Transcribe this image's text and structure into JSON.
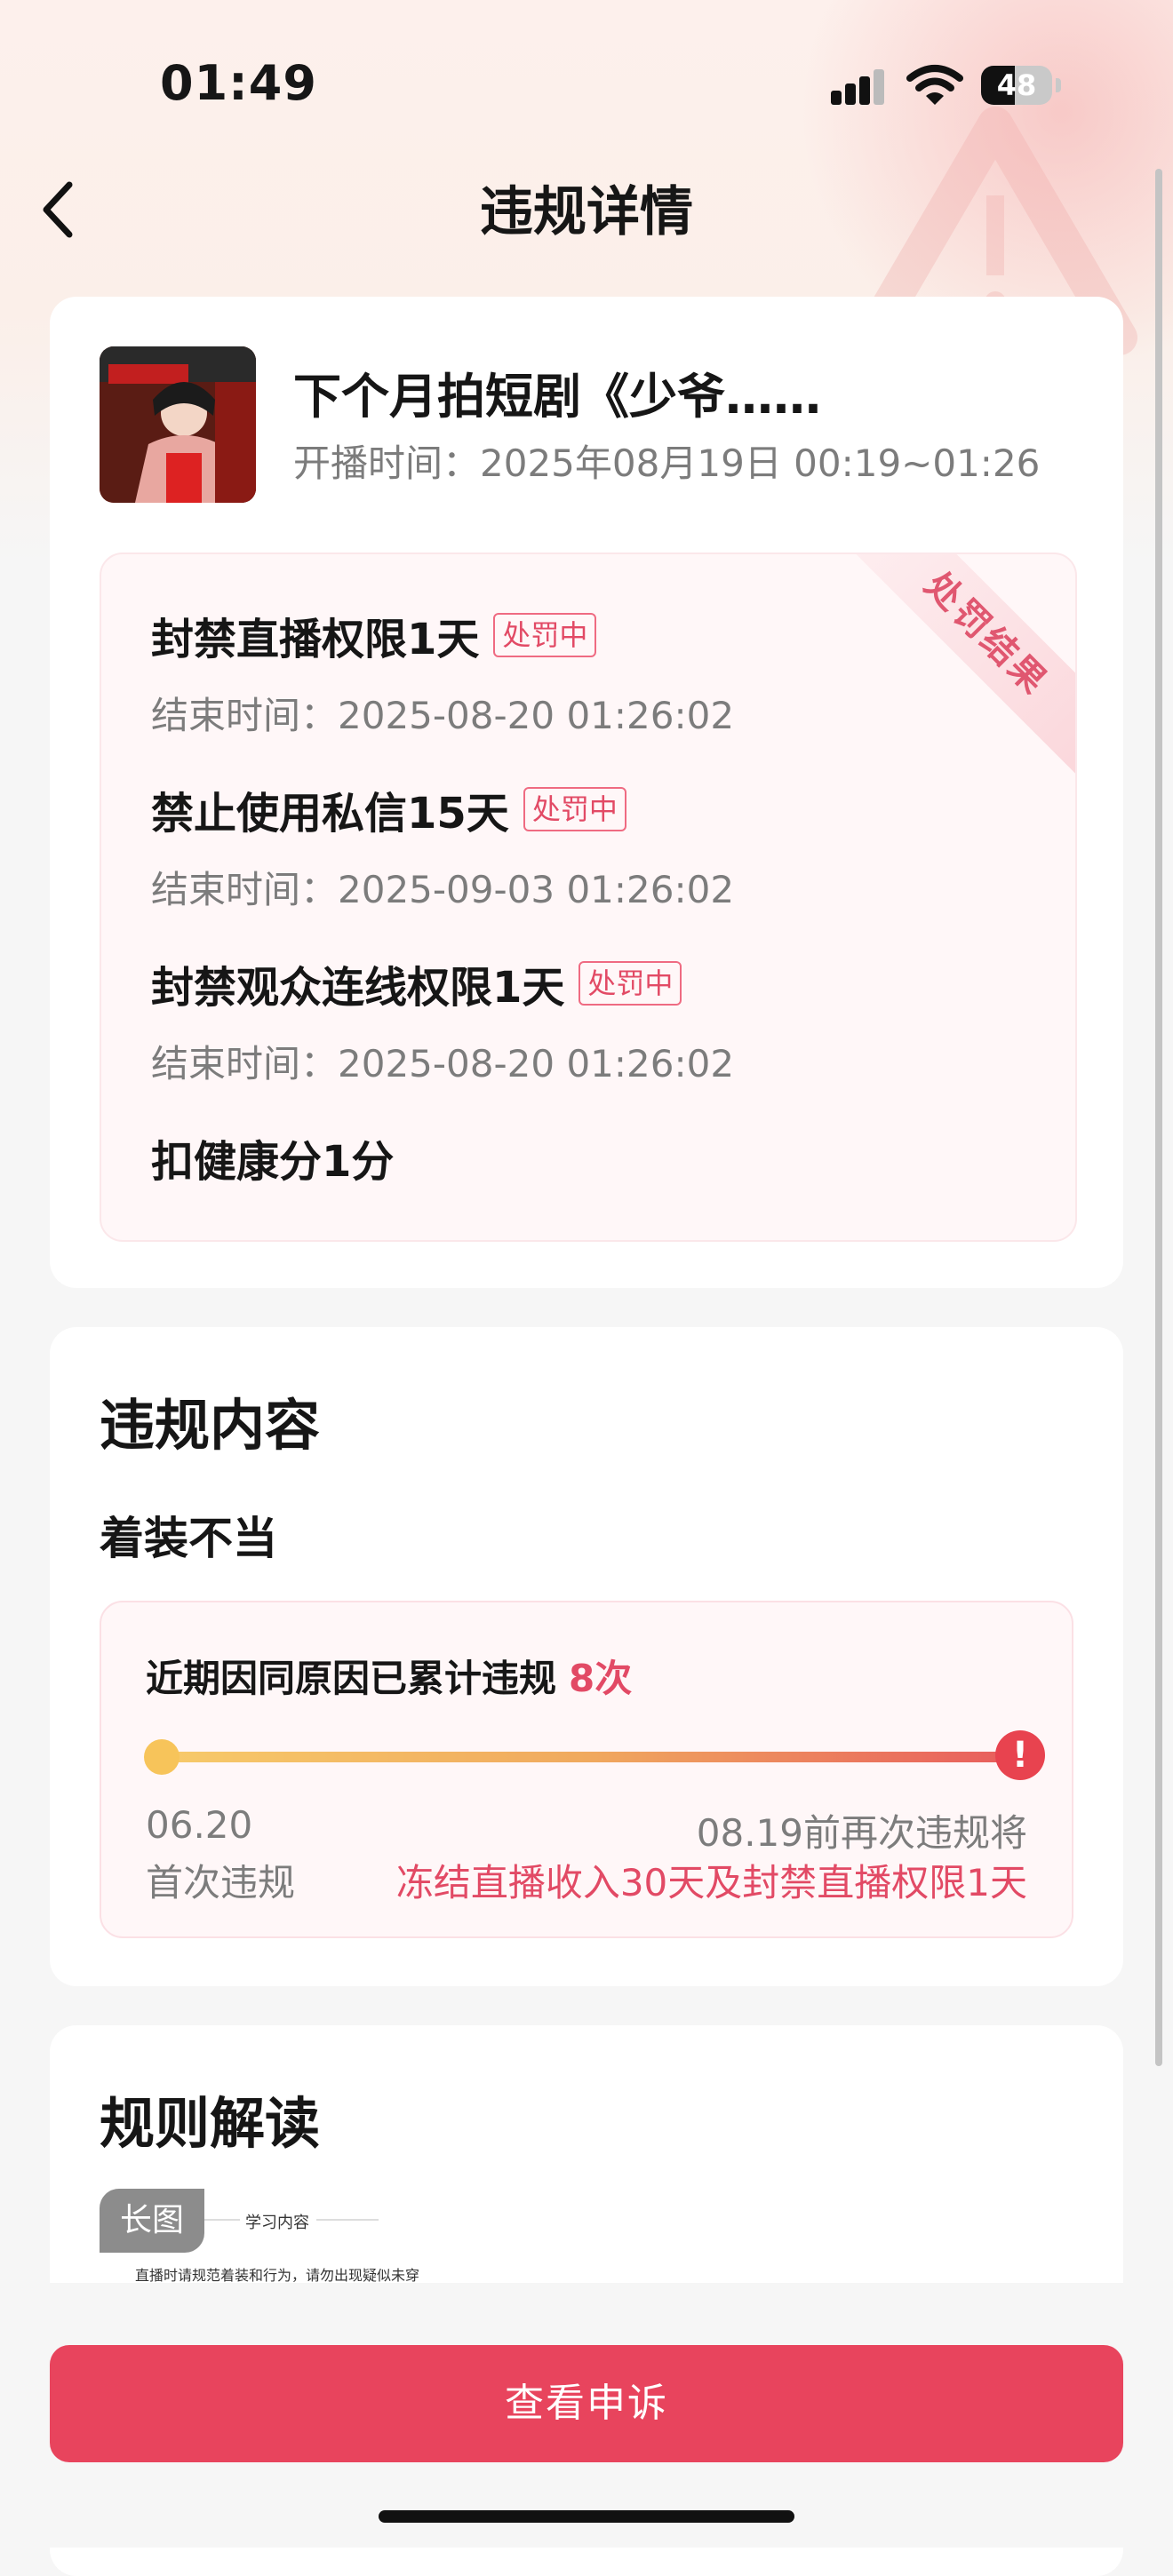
{
  "status_bar": {
    "time": "01:49",
    "battery": "48"
  },
  "header": {
    "title": "违规详情"
  },
  "live": {
    "title": "下个月拍短剧《少爷……",
    "time_label": "开播时间：",
    "time_value": "2025年08月19日 00:19~01:26"
  },
  "penalty": {
    "ribbon": "处罚结果",
    "items": [
      {
        "name": "封禁直播权限1天",
        "status": "处罚中",
        "end_label": "结束时间：",
        "end_value": "2025-08-20 01:26:02"
      },
      {
        "name": "禁止使用私信15天",
        "status": "处罚中",
        "end_label": "结束时间：",
        "end_value": "2025-09-03 01:26:02"
      },
      {
        "name": "封禁观众连线权限1天",
        "status": "处罚中",
        "end_label": "结束时间：",
        "end_value": "2025-08-20 01:26:02"
      },
      {
        "name": "扣健康分1分"
      }
    ]
  },
  "violation": {
    "title": "违规内容",
    "reason": "着装不当",
    "count_text": "近期因同原因已累计违规",
    "count_value": "8次",
    "first_date": "06.20",
    "first_label": "首次违规",
    "next_date": "08.19前再次违规将",
    "next_penalty": "冻结直播收入30天及封禁直播权限1天"
  },
  "rules": {
    "title": "规则解读",
    "long_image_tag": "长图",
    "thumb_heading": "学习内容",
    "thumb_text": "直播时请规范着装和行为，请勿出现疑似未穿衣、半"
  },
  "footer": {
    "appeal_button": "查看申诉"
  },
  "colors": {
    "accent": "#e8445d",
    "tag_red": "#e24a65"
  },
  "icons": [
    "back-chevron-icon",
    "signal-icon",
    "wifi-icon",
    "battery-icon",
    "warning-icon"
  ]
}
